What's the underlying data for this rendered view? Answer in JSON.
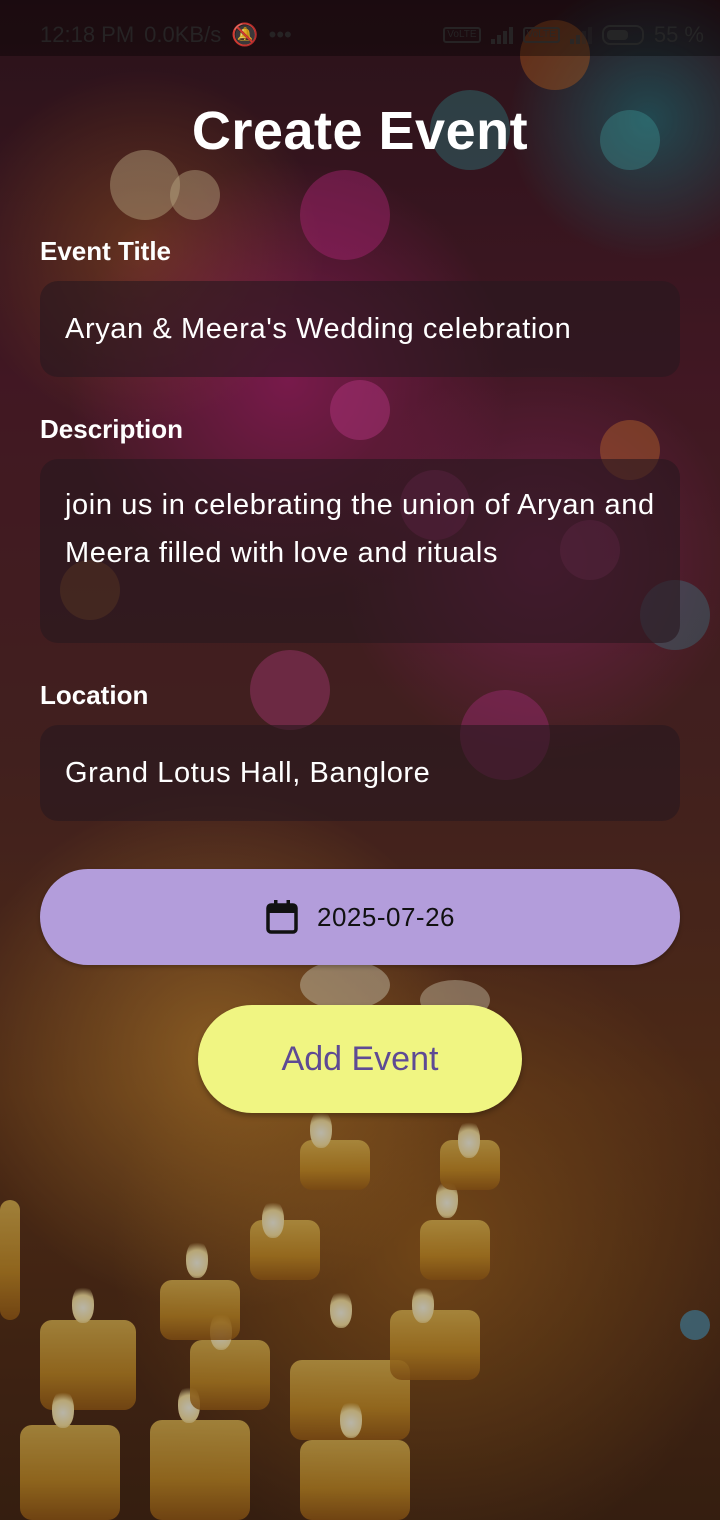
{
  "status_bar": {
    "time": "12:18 PM",
    "network_speed": "0.0KB/s",
    "more": "•••",
    "network_type": "4G+",
    "battery": "55"
  },
  "page": {
    "title": "Create Event"
  },
  "form": {
    "event_title": {
      "label": "Event Title",
      "value": "Aryan & Meera's Wedding celebration"
    },
    "description": {
      "label": "Description",
      "value": "join us in celebrating the union of Aryan and Meera filled with love and rituals"
    },
    "location": {
      "label": "Location",
      "value": "Grand Lotus Hall, Banglore"
    },
    "date_button": {
      "icon": "calendar-icon",
      "value": "2025-07-26"
    },
    "submit_label": "Add Event"
  },
  "colors": {
    "date_button_bg": "#b39ddb",
    "add_button_bg": "#f0f582",
    "add_button_text": "#5e4a94",
    "field_bg": "rgba(40,25,30,0.62)",
    "title_text": "#ffffff"
  }
}
